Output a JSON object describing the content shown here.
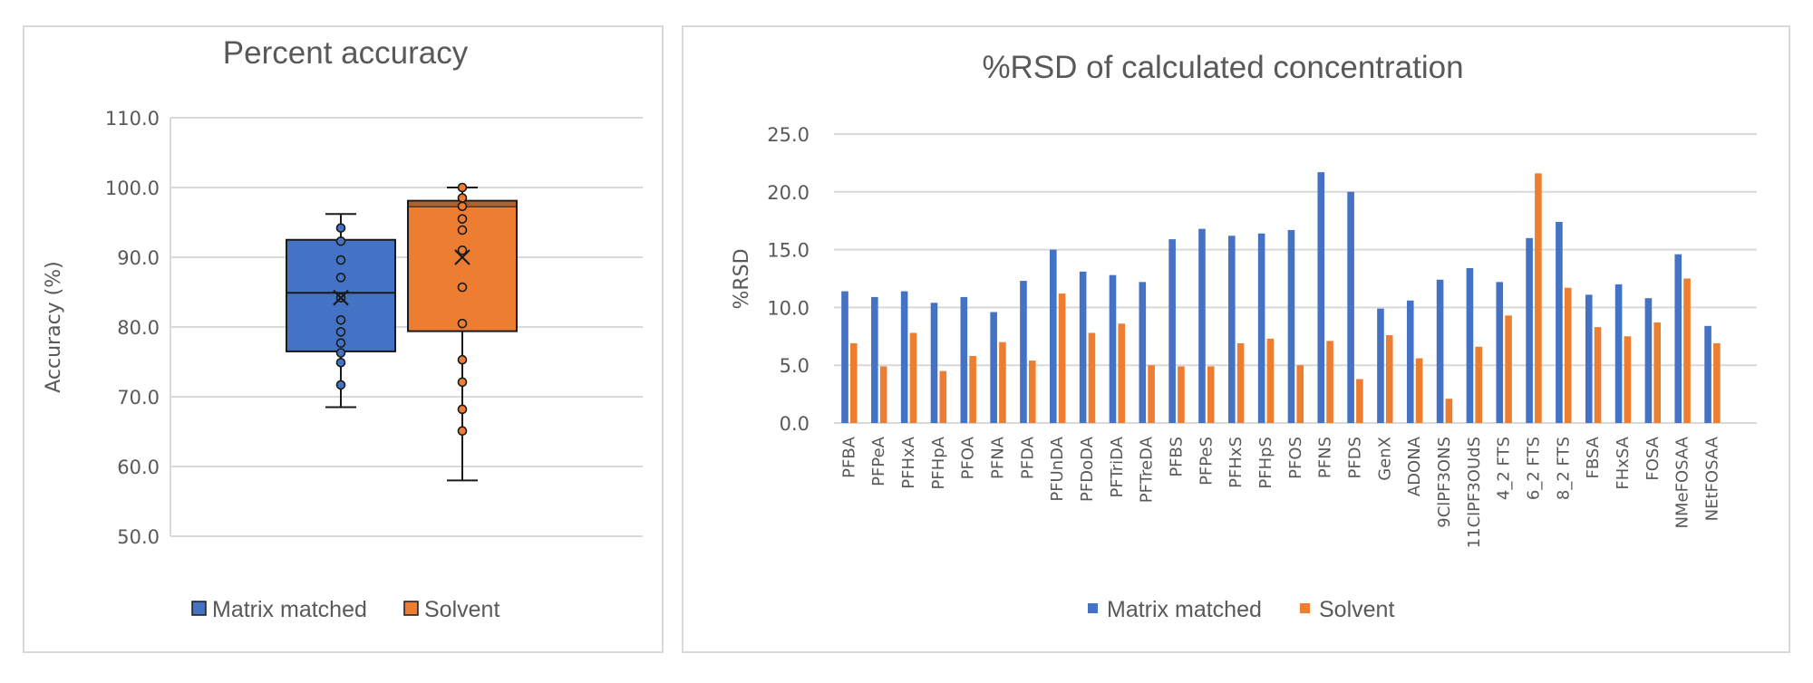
{
  "colors": {
    "matrix": "#4472C4",
    "solvent": "#ED7D31",
    "text": "#595959",
    "grid": "#D9D9D9",
    "outline": "#1a1a1a"
  },
  "chart_data": [
    {
      "type": "box",
      "title": "Percent accuracy",
      "xlabel": "",
      "ylabel": "Accuracy (%)",
      "ylim": [
        50,
        110
      ],
      "yticks": [
        "50.0",
        "60.0",
        "70.0",
        "80.0",
        "90.0",
        "100.0",
        "110.0"
      ],
      "grid": true,
      "legend": {
        "position": "bottom",
        "entries": [
          "Matrix matched",
          "Solvent"
        ]
      },
      "series": [
        {
          "name": "Matrix matched",
          "whisker_low": 68.5,
          "q1": 76.5,
          "median": 84.9,
          "q3": 92.5,
          "whisker_high": 96.2,
          "mean": 84.2,
          "points": [
            94.2,
            92.3,
            89.6,
            87.1,
            84.2,
            81.0,
            79.3,
            77.7,
            76.3,
            74.9,
            71.7
          ]
        },
        {
          "name": "Solvent",
          "whisker_low": 58.0,
          "q1": 79.4,
          "median": 97.3,
          "q3": 98.1,
          "whisker_high": 100.0,
          "mean": 90.0,
          "points": [
            100.0,
            98.5,
            97.3,
            95.5,
            93.9,
            91.0,
            85.7,
            80.5,
            75.3,
            72.1,
            68.2,
            65.1
          ]
        }
      ]
    },
    {
      "type": "bar",
      "title": "%RSD of calculated concentration",
      "xlabel": "",
      "ylabel": "%RSD",
      "ylim": [
        0,
        25
      ],
      "yticks": [
        "0.0",
        "5.0",
        "10.0",
        "15.0",
        "20.0",
        "25.0"
      ],
      "grid": true,
      "legend": {
        "position": "bottom",
        "entries": [
          "Matrix matched",
          "Solvent"
        ]
      },
      "categories": [
        "PFBA",
        "PFPeA",
        "PFHxA",
        "PFHpA",
        "PFOA",
        "PFNA",
        "PFDA",
        "PFUnDA",
        "PFDoDA",
        "PFTriDA",
        "PFTreDA",
        "PFBS",
        "PFPeS",
        "PFHxS",
        "PFHpS",
        "PFOS",
        "PFNS",
        "PFDS",
        "GenX",
        "ADONA",
        "9ClPF3ONS",
        "11ClPF3OUdS",
        "4_2 FTS",
        "6_2 FTS",
        "8_2 FTS",
        "FBSA",
        "FHxSA",
        "FOSA",
        "NMeFOSAA",
        "NEtFOSAA"
      ],
      "series": [
        {
          "name": "Matrix matched",
          "values": [
            11.4,
            10.9,
            11.4,
            10.4,
            10.9,
            9.6,
            12.3,
            15.0,
            13.1,
            12.8,
            12.2,
            15.9,
            16.8,
            16.2,
            16.4,
            16.7,
            21.7,
            20.0,
            9.9,
            10.6,
            12.4,
            13.4,
            12.2,
            16.0,
            17.4,
            11.1,
            12.0,
            10.8,
            14.6,
            8.4
          ]
        },
        {
          "name": "Solvent",
          "values": [
            6.9,
            4.9,
            7.8,
            4.5,
            5.8,
            7.0,
            5.4,
            11.2,
            7.8,
            8.6,
            5.0,
            4.9,
            4.9,
            6.9,
            7.3,
            5.0,
            7.1,
            3.8,
            7.6,
            5.6,
            2.1,
            6.6,
            9.3,
            21.6,
            11.7,
            8.3,
            7.5,
            8.7,
            12.5,
            6.9
          ]
        }
      ]
    }
  ]
}
